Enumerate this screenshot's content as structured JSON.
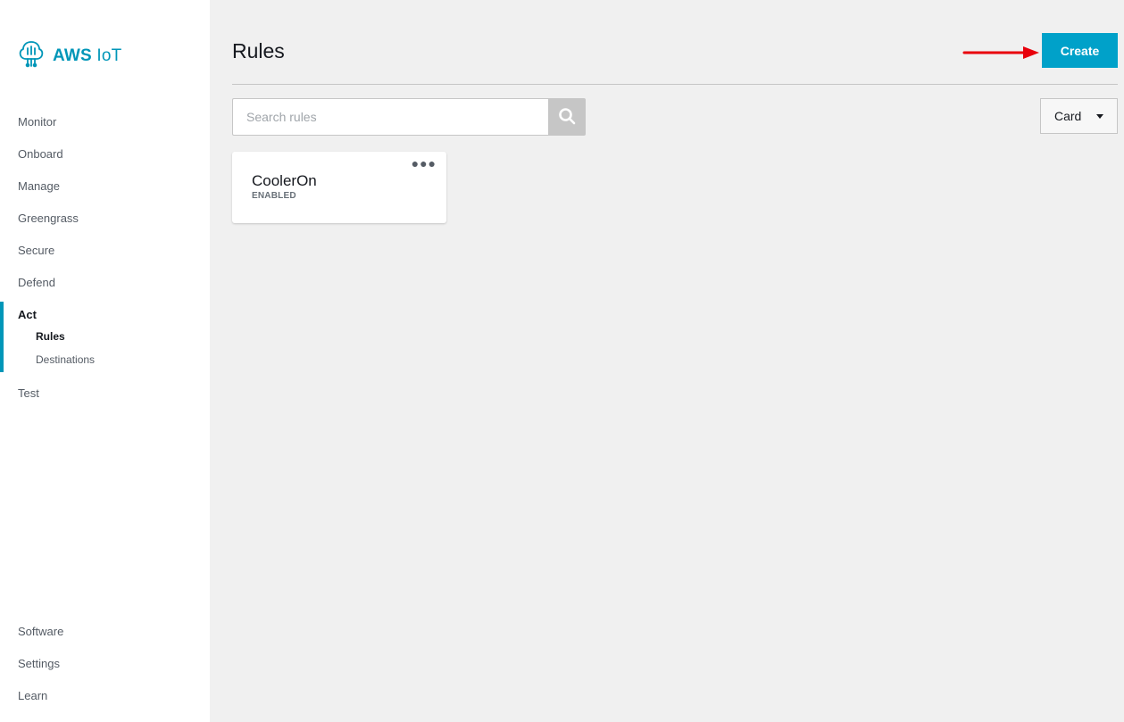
{
  "brand": {
    "name_bold": "AWS",
    "name_rest": " IoT",
    "color": "#0096b8"
  },
  "sidebar": {
    "items": [
      {
        "label": "Monitor"
      },
      {
        "label": "Onboard"
      },
      {
        "label": "Manage"
      },
      {
        "label": "Greengrass"
      },
      {
        "label": "Secure"
      },
      {
        "label": "Defend"
      },
      {
        "label": "Act",
        "active": true
      },
      {
        "label": "Test"
      }
    ],
    "act_children": [
      {
        "label": "Rules",
        "active": true
      },
      {
        "label": "Destinations"
      }
    ],
    "footer_items": [
      {
        "label": "Software"
      },
      {
        "label": "Settings"
      },
      {
        "label": "Learn"
      }
    ]
  },
  "main": {
    "title": "Rules",
    "create_label": "Create",
    "search": {
      "placeholder": "Search rules",
      "value": ""
    },
    "view_select": {
      "selected": "Card"
    },
    "rules": [
      {
        "name": "CoolerOn",
        "status": "ENABLED"
      }
    ]
  },
  "colors": {
    "accent": "#00a1c9",
    "annotation_arrow": "#e8000b"
  },
  "icons": {
    "logo": "aws-iot-logo-icon",
    "search": "search-icon",
    "more": "more-options-icon",
    "caret": "caret-down-icon",
    "arrow": "arrow-right-icon"
  }
}
